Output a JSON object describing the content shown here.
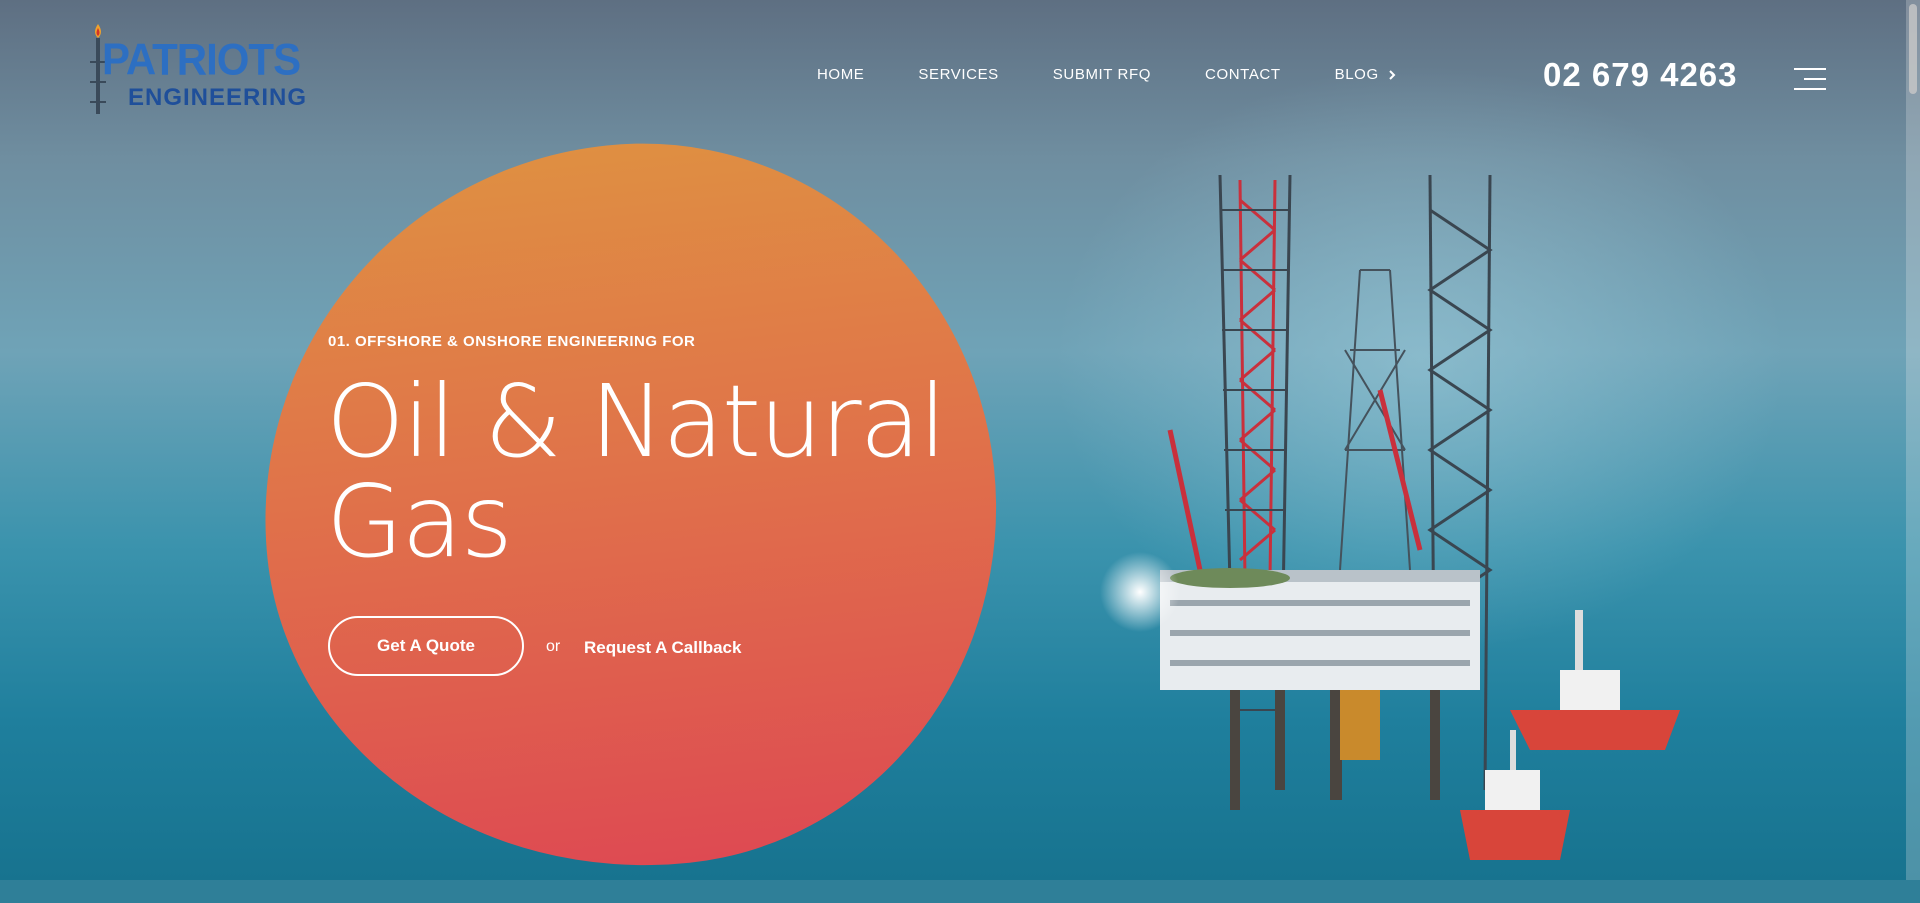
{
  "logo": {
    "line1": "PATRIOTS",
    "line2": "ENGINEERING"
  },
  "nav": {
    "items": [
      {
        "label": "HOME"
      },
      {
        "label": "SERVICES"
      },
      {
        "label": "SUBMIT RFQ"
      },
      {
        "label": "CONTACT"
      },
      {
        "label": "BLOG",
        "has_chevron": true
      }
    ]
  },
  "phone": "02 679 4263",
  "hero": {
    "eyebrow": "01. OFFSHORE & ONSHORE ENGINEERING FOR",
    "headline_line1": "Oil & Natural",
    "headline_line2": "Gas",
    "primary_button": "Get A Quote",
    "or_text": "or",
    "secondary_link": "Request A Callback"
  },
  "icons": {
    "menu": "hamburger-menu-icon",
    "chevron": "chevron-right-icon",
    "flame": "flame-icon"
  },
  "colors": {
    "blob_top": "#df8f42",
    "blob_bottom": "#de4a52",
    "logo_blue": "#2d6fc2",
    "sea": "#1f7f9d"
  }
}
